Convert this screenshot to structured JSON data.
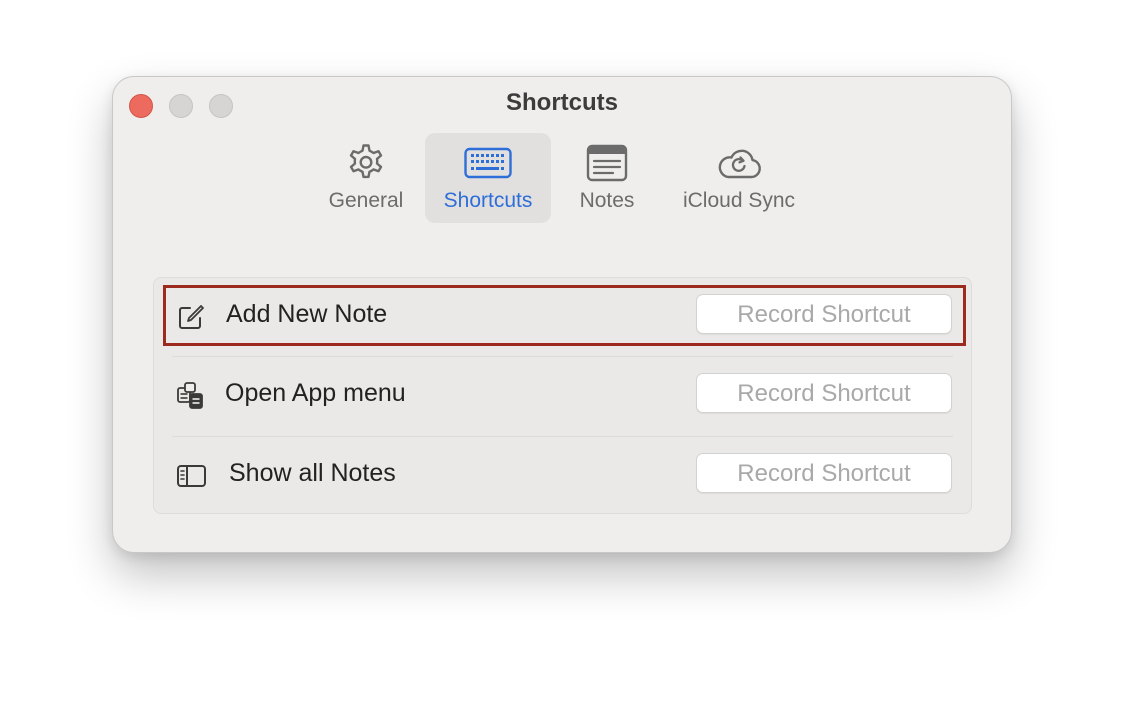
{
  "window": {
    "title": "Shortcuts"
  },
  "tabs": [
    {
      "label": "General",
      "icon": "gear-icon",
      "active": false
    },
    {
      "label": "Shortcuts",
      "icon": "keyboard-icon",
      "active": true
    },
    {
      "label": "Notes",
      "icon": "notes-icon",
      "active": false
    },
    {
      "label": "iCloud Sync",
      "icon": "icloud-sync-icon",
      "active": false
    }
  ],
  "shortcuts": [
    {
      "label": "Add New Note",
      "icon": "compose-icon",
      "button_label": "Record Shortcut",
      "highlighted": true
    },
    {
      "label": "Open App menu",
      "icon": "app-menu-icon",
      "button_label": "Record Shortcut",
      "highlighted": false
    },
    {
      "label": "Show all Notes",
      "icon": "sidebar-icon",
      "button_label": "Record Shortcut",
      "highlighted": false
    }
  ],
  "colors": {
    "accent": "#2e6ed8",
    "highlight_border": "#9c2a1e",
    "close_button": "#ed6a5e"
  }
}
